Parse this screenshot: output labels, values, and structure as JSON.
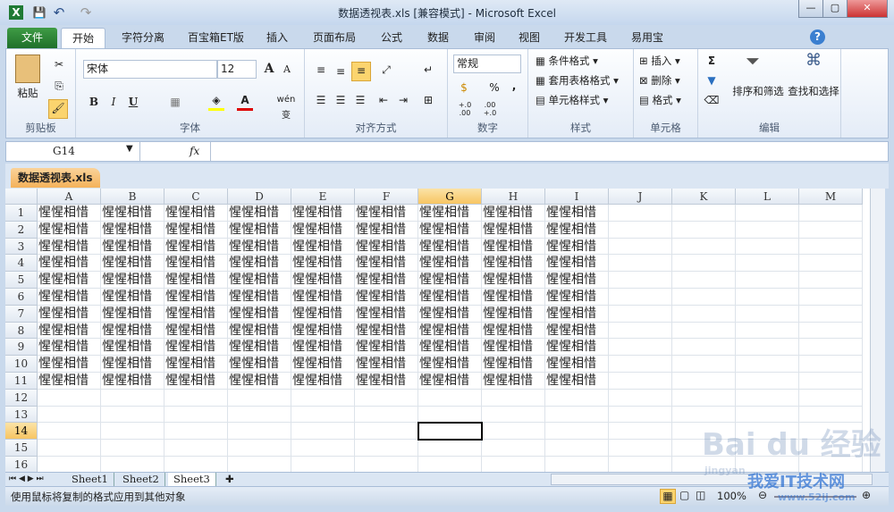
{
  "window": {
    "title": "数据透视表.xls  [兼容模式] - Microsoft Excel",
    "minimize": "—",
    "restore": "▢",
    "close": "✕"
  },
  "quick_access": {
    "app_icon": "X",
    "save": "💾",
    "undo": "↶",
    "redo": "↷"
  },
  "tabs": [
    "文件",
    "开始",
    "字符分离",
    "百宝箱ET版",
    "插入",
    "页面布局",
    "公式",
    "数据",
    "审阅",
    "视图",
    "开发工具",
    "易用宝"
  ],
  "active_tab": "开始",
  "ribbon": {
    "clipboard": {
      "label": "剪贴板",
      "paste": "粘贴"
    },
    "font": {
      "label": "字体",
      "font_name": "宋体",
      "font_size": "12",
      "bold": "B",
      "italic": "I",
      "underline": "U",
      "grow": "A",
      "shrink": "A",
      "wen": "wén 变"
    },
    "alignment": {
      "label": "对齐方式"
    },
    "number": {
      "label": "数字",
      "format": "常规",
      "percent": "%",
      "comma": ",",
      "inc_dec": "+.0 .00",
      "dec_dec": ".00 +.0"
    },
    "styles": {
      "label": "样式",
      "conditional": "条件格式",
      "table": "套用表格格式",
      "cell_styles": "单元格样式"
    },
    "cells": {
      "label": "单元格",
      "insert": "插入",
      "delete": "删除",
      "format": "格式"
    },
    "editing": {
      "label": "编辑",
      "sum": "Σ",
      "sort_filter": "排序和筛选",
      "find_select": "查找和选择"
    }
  },
  "formula_bar": {
    "name_box": "G14",
    "fx": "fx",
    "formula": ""
  },
  "document_tab": "数据透视表.xls",
  "sheet": {
    "columns": [
      "A",
      "B",
      "C",
      "D",
      "E",
      "F",
      "G",
      "H",
      "I",
      "J",
      "K",
      "L",
      "M"
    ],
    "rows": [
      "1",
      "2",
      "3",
      "4",
      "5",
      "6",
      "7",
      "8",
      "9",
      "10",
      "11",
      "12",
      "13",
      "14",
      "15",
      "16"
    ],
    "selected_cell": "G14",
    "cells": [
      [
        "惺惺相惜",
        "惺惺相惜",
        "惺惺相惜",
        "惺惺相惜",
        "惺惺相惜",
        "惺惺相惜",
        "惺惺相惜",
        "惺惺相惜",
        "惺惺相惜"
      ],
      [
        "惺惺相惜",
        "惺惺相惜",
        "惺惺相惜",
        "惺惺相惜",
        "惺惺相惜",
        "惺惺相惜",
        "惺惺相惜",
        "惺惺相惜",
        "惺惺相惜"
      ],
      [
        "惺惺相惜",
        "惺惺相惜",
        "惺惺相惜",
        "惺惺相惜",
        "惺惺相惜",
        "惺惺相惜",
        "惺惺相惜",
        "惺惺相惜",
        "惺惺相惜"
      ],
      [
        "惺惺相惜",
        "惺惺相惜",
        "惺惺相惜",
        "惺惺相惜",
        "惺惺相惜",
        "惺惺相惜",
        "惺惺相惜",
        "惺惺相惜",
        "惺惺相惜"
      ],
      [
        "惺惺相惜",
        "惺惺相惜",
        "惺惺相惜",
        "惺惺相惜",
        "惺惺相惜",
        "惺惺相惜",
        "惺惺相惜",
        "惺惺相惜",
        "惺惺相惜"
      ],
      [
        "惺惺相惜",
        "惺惺相惜",
        "惺惺相惜",
        "惺惺相惜",
        "惺惺相惜",
        "惺惺相惜",
        "惺惺相惜",
        "惺惺相惜",
        "惺惺相惜"
      ],
      [
        "惺惺相惜",
        "惺惺相惜",
        "惺惺相惜",
        "惺惺相惜",
        "惺惺相惜",
        "惺惺相惜",
        "惺惺相惜",
        "惺惺相惜",
        "惺惺相惜"
      ],
      [
        "惺惺相惜",
        "惺惺相惜",
        "惺惺相惜",
        "惺惺相惜",
        "惺惺相惜",
        "惺惺相惜",
        "惺惺相惜",
        "惺惺相惜",
        "惺惺相惜"
      ],
      [
        "惺惺相惜",
        "惺惺相惜",
        "惺惺相惜",
        "惺惺相惜",
        "惺惺相惜",
        "惺惺相惜",
        "惺惺相惜",
        "惺惺相惜",
        "惺惺相惜"
      ],
      [
        "惺惺相惜",
        "惺惺相惜",
        "惺惺相惜",
        "惺惺相惜",
        "惺惺相惜",
        "惺惺相惜",
        "惺惺相惜",
        "惺惺相惜",
        "惺惺相惜"
      ],
      [
        "惺惺相惜",
        "惺惺相惜",
        "惺惺相惜",
        "惺惺相惜",
        "惺惺相惜",
        "惺惺相惜",
        "惺惺相惜",
        "惺惺相惜",
        "惺惺相惜"
      ]
    ]
  },
  "sheet_tabs": [
    "Sheet1",
    "Sheet2",
    "Sheet3"
  ],
  "active_sheet": "Sheet3",
  "status": {
    "message": "使用鼠标将复制的格式应用到其他对象",
    "zoom": "100%"
  },
  "watermarks": {
    "baidu": "Bai du 经验",
    "site": "我爱IT技术网",
    "url": "www.52ij.com",
    "jingyan": "jingyan"
  }
}
